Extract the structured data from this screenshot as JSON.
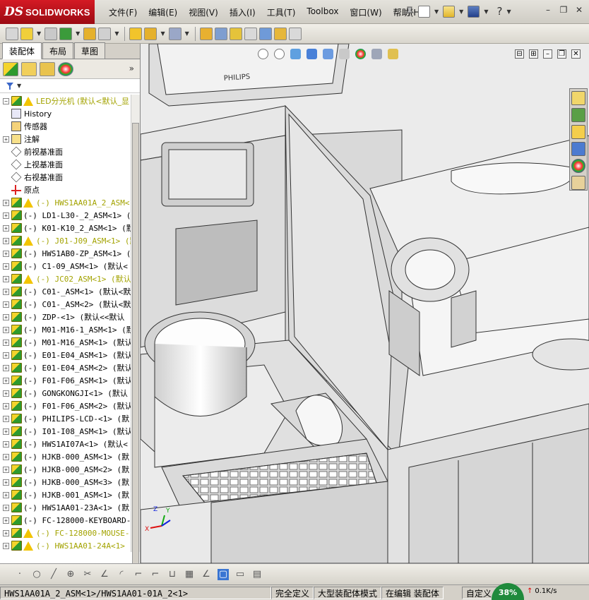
{
  "app": {
    "brand_ds": "DS",
    "brand_name": "SOLIDWORKS"
  },
  "menu": [
    "文件(F)",
    "编辑(E)",
    "视图(V)",
    "插入(I)",
    "工具(T)",
    "Toolbox",
    "窗口(W)",
    "帮助(H)"
  ],
  "top_icons": [
    "pin-icon",
    "new-file-icon",
    "open-file-icon",
    "save-icon",
    "help-icon"
  ],
  "window_controls": [
    "minimize",
    "restore",
    "close"
  ],
  "tabs": [
    "装配体",
    "布局",
    "草图"
  ],
  "tree": {
    "root": "LED分光机  (默认<默认_显",
    "items": [
      {
        "name": "History",
        "kind": "history",
        "expander": "",
        "warn": false,
        "yellow": false
      },
      {
        "name": "传感器",
        "kind": "sensor",
        "expander": "",
        "warn": false,
        "yellow": false
      },
      {
        "name": "注解",
        "kind": "annotation",
        "expander": "+",
        "warn": false,
        "yellow": false
      },
      {
        "name": "前视基准面",
        "kind": "plane",
        "expander": "",
        "warn": false,
        "yellow": false
      },
      {
        "name": "上视基准面",
        "kind": "plane",
        "expander": "",
        "warn": false,
        "yellow": false
      },
      {
        "name": "右视基准面",
        "kind": "plane",
        "expander": "",
        "warn": false,
        "yellow": false
      },
      {
        "name": "原点",
        "kind": "origin",
        "expander": "",
        "warn": false,
        "yellow": false
      },
      {
        "name": "(-) HWS1AA01A_2_ASM<",
        "kind": "comp",
        "expander": "+",
        "warn": true,
        "yellow": true
      },
      {
        "name": "(-) LD1-L30-_2_ASM<1> (",
        "kind": "comp",
        "expander": "+",
        "warn": false,
        "yellow": false
      },
      {
        "name": "(-) K01-K10_2_ASM<1> (默",
        "kind": "comp",
        "expander": "+",
        "warn": false,
        "yellow": false
      },
      {
        "name": "(-) J01-J09_ASM<1> (默",
        "kind": "comp",
        "expander": "+",
        "warn": true,
        "yellow": true
      },
      {
        "name": "(-) HWS1AB0-ZP_ASM<1> (",
        "kind": "comp",
        "expander": "+",
        "warn": false,
        "yellow": false
      },
      {
        "name": "(-) C1-09_ASM<1> (默认<",
        "kind": "comp",
        "expander": "+",
        "warn": false,
        "yellow": false
      },
      {
        "name": "(-) JC02_ASM<1> (默认<",
        "kind": "comp",
        "expander": "+",
        "warn": true,
        "yellow": true
      },
      {
        "name": "(-) C01-_ASM<1> (默认<默",
        "kind": "comp",
        "expander": "+",
        "warn": false,
        "yellow": false
      },
      {
        "name": "(-) C01-_ASM<2> (默认<默",
        "kind": "comp",
        "expander": "+",
        "warn": false,
        "yellow": false
      },
      {
        "name": "(-) ZDP-<1> (默认<<默认",
        "kind": "comp",
        "expander": "+",
        "warn": false,
        "yellow": false
      },
      {
        "name": "(-) M01-M16-1_ASM<1> (默",
        "kind": "comp",
        "expander": "+",
        "warn": false,
        "yellow": false
      },
      {
        "name": "(-) M01-M16_ASM<1> (默认",
        "kind": "comp",
        "expander": "+",
        "warn": false,
        "yellow": false
      },
      {
        "name": "(-) E01-E04_ASM<1> (默认",
        "kind": "comp",
        "expander": "+",
        "warn": false,
        "yellow": false
      },
      {
        "name": "(-) E01-E04_ASM<2> (默认",
        "kind": "comp",
        "expander": "+",
        "warn": false,
        "yellow": false
      },
      {
        "name": "(-) F01-F06_ASM<1> (默认",
        "kind": "comp",
        "expander": "+",
        "warn": false,
        "yellow": false
      },
      {
        "name": "(-) GONGKONGJI<1> (默认",
        "kind": "comp",
        "expander": "+",
        "warn": false,
        "yellow": false
      },
      {
        "name": "(-) F01-F06_ASM<2> (默认",
        "kind": "comp",
        "expander": "+",
        "warn": false,
        "yellow": false
      },
      {
        "name": "(-) PHILIPS-LCD-<1> (默",
        "kind": "comp",
        "expander": "+",
        "warn": false,
        "yellow": false
      },
      {
        "name": "(-) I01-I08_ASM<1> (默认",
        "kind": "comp",
        "expander": "+",
        "warn": false,
        "yellow": false
      },
      {
        "name": "(-) HWS1AI07A<1> (默认<",
        "kind": "comp",
        "expander": "+",
        "warn": false,
        "yellow": false
      },
      {
        "name": "(-) HJKB-000_ASM<1> (默",
        "kind": "comp",
        "expander": "+",
        "warn": false,
        "yellow": false
      },
      {
        "name": "(-) HJKB-000_ASM<2> (默",
        "kind": "comp",
        "expander": "+",
        "warn": false,
        "yellow": false
      },
      {
        "name": "(-) HJKB-000_ASM<3> (默",
        "kind": "comp",
        "expander": "+",
        "warn": false,
        "yellow": false
      },
      {
        "name": "(-) HJKB-001_ASM<1> (默",
        "kind": "comp",
        "expander": "+",
        "warn": false,
        "yellow": false
      },
      {
        "name": "(-) HWS1AA01-23A<1> (默",
        "kind": "comp",
        "expander": "+",
        "warn": false,
        "yellow": false
      },
      {
        "name": "(-) FC-128000-KEYBOARD-",
        "kind": "comp",
        "expander": "+",
        "warn": false,
        "yellow": false
      },
      {
        "name": "(-) FC-128000-MOUSE-",
        "kind": "comp",
        "expander": "+",
        "warn": true,
        "yellow": true
      },
      {
        "name": "(-) HWS1AA01-24A<1>",
        "kind": "comp",
        "expander": "+",
        "warn": true,
        "yellow": true
      }
    ]
  },
  "viewport": {
    "monitor_label": "PHILIPS",
    "triad_x": "X",
    "triad_y": "Y",
    "triad_z": "Z"
  },
  "status": {
    "path": "HWS1AA01A_2_ASM<1>/HWS1AA01-01A_2<1>",
    "definition": "完全定义",
    "mode": "大型装配体模式",
    "editing": "在编辑 装配体",
    "custom": "自定义",
    "perf": "38%",
    "speed": "0.1K/s"
  }
}
